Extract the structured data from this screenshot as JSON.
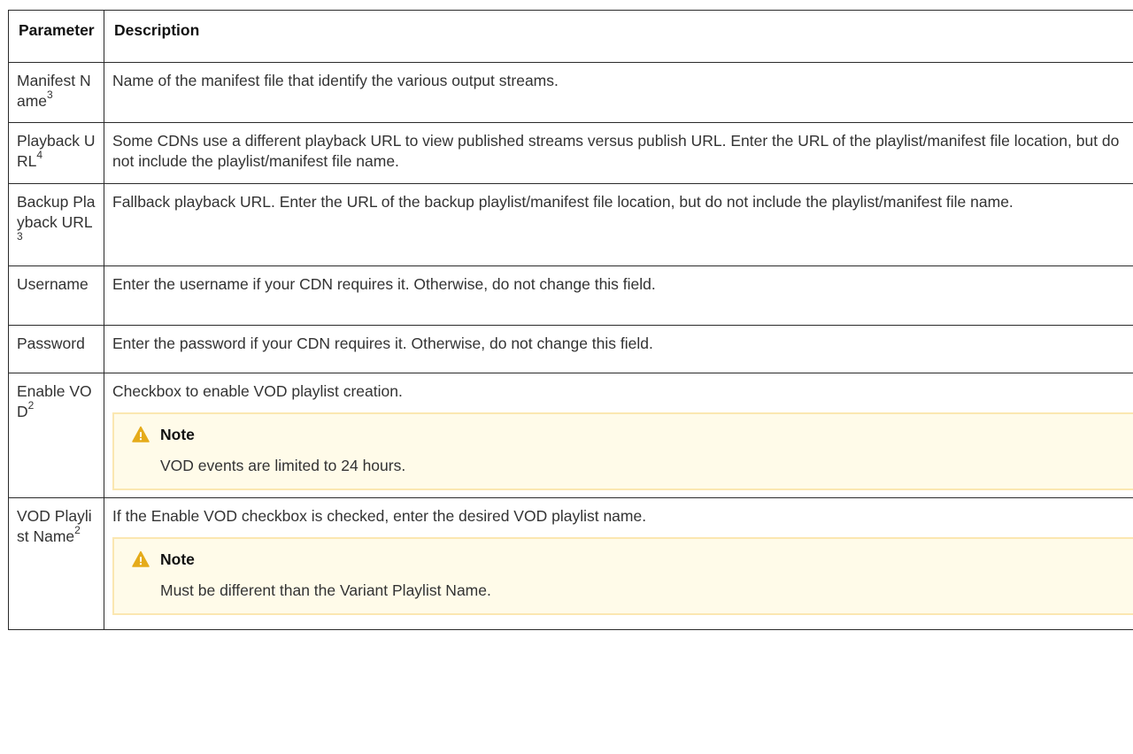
{
  "table": {
    "header": {
      "param": "Parameter",
      "description": "Description"
    },
    "rows": [
      {
        "param": "Manifest Name",
        "sup": "3",
        "description": "Name of the manifest file that identify the various output streams."
      },
      {
        "param": "Playback URL",
        "sup": "4",
        "description": "Some CDNs use a different playback URL to view published streams versus publish URL. Enter the URL of the playlist/manifest file location, but do not include the playlist/manifest file name."
      },
      {
        "param": "Backup Playback URL",
        "sup": "3",
        "description": "Fallback playback URL. Enter the URL of the backup playlist/manifest file location, but do not include the playlist/manifest file name."
      },
      {
        "param": "Username",
        "sup": "",
        "description": "Enter the username if your CDN requires it. Otherwise, do not change this field."
      },
      {
        "param": "Password",
        "sup": "",
        "description": "Enter the password if your CDN requires it. Otherwise, do not change this field."
      },
      {
        "param": "Enable VOD",
        "sup": "2",
        "description": "Checkbox to enable VOD playlist creation.",
        "note": {
          "title": "Note",
          "icon": "warning-icon",
          "text": "VOD events are limited to 24 hours."
        }
      },
      {
        "param": "VOD Playlist Name",
        "sup": "2",
        "description": "If the Enable VOD checkbox is checked, enter the desired VOD playlist name.",
        "note": {
          "title": "Note",
          "icon": "warning-icon",
          "text": "Must be different than the Variant Playlist Name."
        }
      }
    ]
  },
  "colors": {
    "note_bg": "#fffbe9",
    "note_border": "#fbe7b1",
    "warning_icon": "#e5ab1a",
    "border": "#2a2a2a"
  }
}
